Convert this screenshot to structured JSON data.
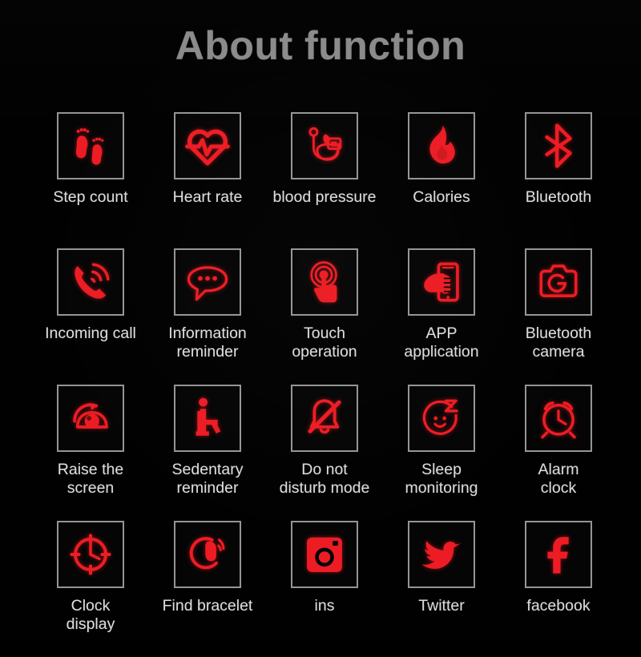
{
  "header": {
    "title": "About function"
  },
  "colors": {
    "background": "#010101",
    "icon_red": "#ed1c24",
    "box_border": "#959595",
    "label_text": "#dcdcdc",
    "title_text": "#8a8a8a"
  },
  "grid": {
    "columns": 5,
    "rows": 4,
    "items": [
      {
        "label": "Step count",
        "icon": "footprints-icon"
      },
      {
        "label": "Heart rate",
        "icon": "heart-pulse-icon"
      },
      {
        "label": "blood pressure",
        "icon": "blood-pressure-monitor-icon"
      },
      {
        "label": "Calories",
        "icon": "flame-icon"
      },
      {
        "label": "Bluetooth",
        "icon": "bluetooth-icon"
      },
      {
        "label": "Incoming call",
        "icon": "ringing-phone-icon"
      },
      {
        "label": "Information\nreminder",
        "icon": "speech-bubble-dots-icon"
      },
      {
        "label": "Touch\noperation",
        "icon": "hand-tap-ripple-icon"
      },
      {
        "label": "APP\napplication",
        "icon": "hand-holding-phone-icon"
      },
      {
        "label": "Bluetooth\ncamera",
        "icon": "camera-icon"
      },
      {
        "label": "Raise the\nscreen",
        "icon": "eye-rotate-icon"
      },
      {
        "label": "Sedentary\nreminder",
        "icon": "sitting-person-icon"
      },
      {
        "label": "Do not\ndisturb mode",
        "icon": "bell-slash-icon"
      },
      {
        "label": "Sleep\nmonitoring",
        "icon": "sleeping-face-z-icon"
      },
      {
        "label": "Alarm\nclock",
        "icon": "alarm-clock-icon"
      },
      {
        "label": "Clock\ndisplay",
        "icon": "clock-dial-icon"
      },
      {
        "label": "Find bracelet",
        "icon": "bracelet-signal-icon"
      },
      {
        "label": "ins",
        "icon": "instagram-icon"
      },
      {
        "label": "Twitter",
        "icon": "twitter-bird-icon"
      },
      {
        "label": "facebook",
        "icon": "facebook-f-icon"
      }
    ]
  }
}
